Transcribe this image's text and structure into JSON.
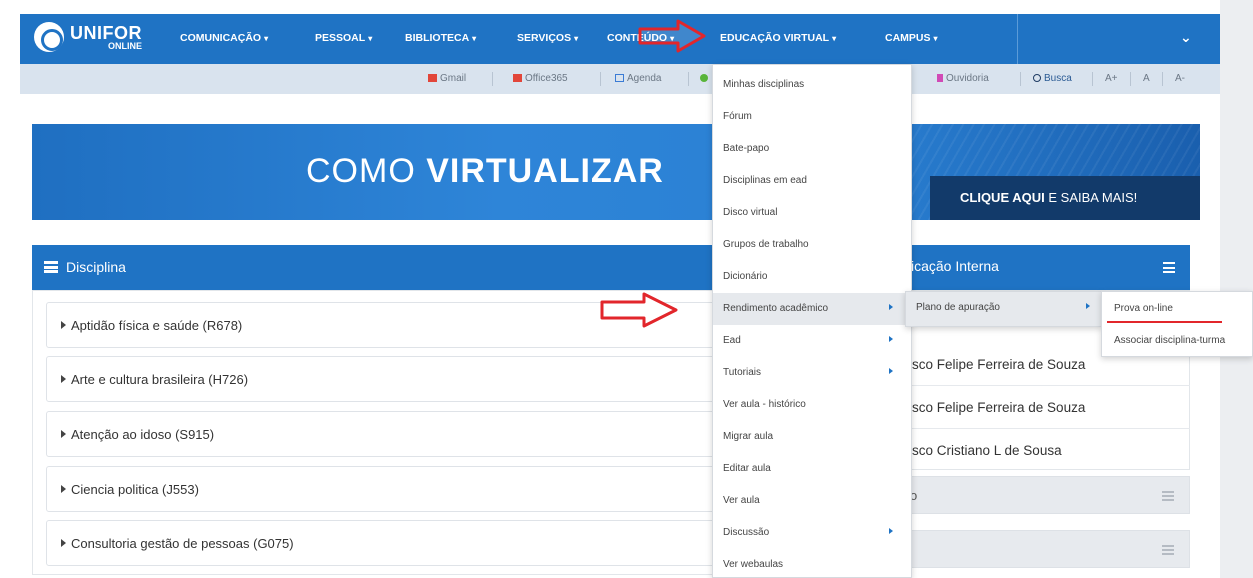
{
  "logo": {
    "main": "UNIFOR",
    "sub": "ONLINE"
  },
  "nav": {
    "items": [
      {
        "label": "COMUNICAÇÃO",
        "caret": "▾"
      },
      {
        "label": "PESSOAL",
        "caret": "▾"
      },
      {
        "label": "BIBLIOTECA",
        "caret": "▾"
      },
      {
        "label": "SERVIÇOS",
        "caret": "▾"
      },
      {
        "label": "CONTEÚDO",
        "caret": "▾"
      },
      {
        "label": "EDUCAÇÃO VIRTUAL",
        "caret": "▾"
      },
      {
        "label": "CAMPUS",
        "caret": "▾"
      }
    ],
    "chevron": "⌄"
  },
  "subbar": {
    "items": [
      "Gmail",
      "Office365",
      "Agenda",
      "Ouvidoria",
      "Busca",
      "A+",
      "A",
      "A-"
    ],
    "icon_colors": {
      "gmail": "#e2463a",
      "office": "#e2463a",
      "agenda": "#3a7bd5",
      "green": "#59b53a",
      "ouvidoria": "#d14ab6"
    }
  },
  "banner": {
    "title_light": "COMO ",
    "title_bold": "VIRTUALIZAR",
    "cta_bold": "CLIQUE AQUI",
    "cta_rest": " E SAIBA MAIS!"
  },
  "disciplina": {
    "title": "Disciplina",
    "courses": [
      "Aptidão física e saúde (R678)",
      "Arte e cultura brasileira (H726)",
      "Atenção ao idoso (S915)",
      "Ciencia politica (J553)",
      "Consultoria gestão de pessoas (G075)"
    ]
  },
  "right_panel": {
    "title": "icação Interna",
    "people": [
      "sco Felipe Ferreira de Souza",
      "sco Felipe Ferreira de Souza",
      "sco Cristiano L de Sousa"
    ],
    "gray_row_1": "o",
    "gray_row_2": ""
  },
  "menu_educacao": {
    "items": [
      "Minhas disciplinas",
      "Fórum",
      "Bate-papo",
      "Disciplinas em ead",
      "Disco virtual",
      "Grupos de trabalho",
      "Dicionário",
      "Rendimento acadêmico",
      "Ead",
      "Tutoriais",
      "Ver aula - histórico",
      "Migrar aula",
      "Editar aula",
      "Ver aula",
      "Discussão",
      "Ver webaulas"
    ]
  },
  "submenu_rendimento": {
    "item": "Plano de apuração"
  },
  "submenu_plano": {
    "items": [
      "Prova on-line",
      "Associar disciplina-turma"
    ]
  },
  "colors": {
    "brand": "#1f73c4",
    "annotation": "#e2262b"
  }
}
